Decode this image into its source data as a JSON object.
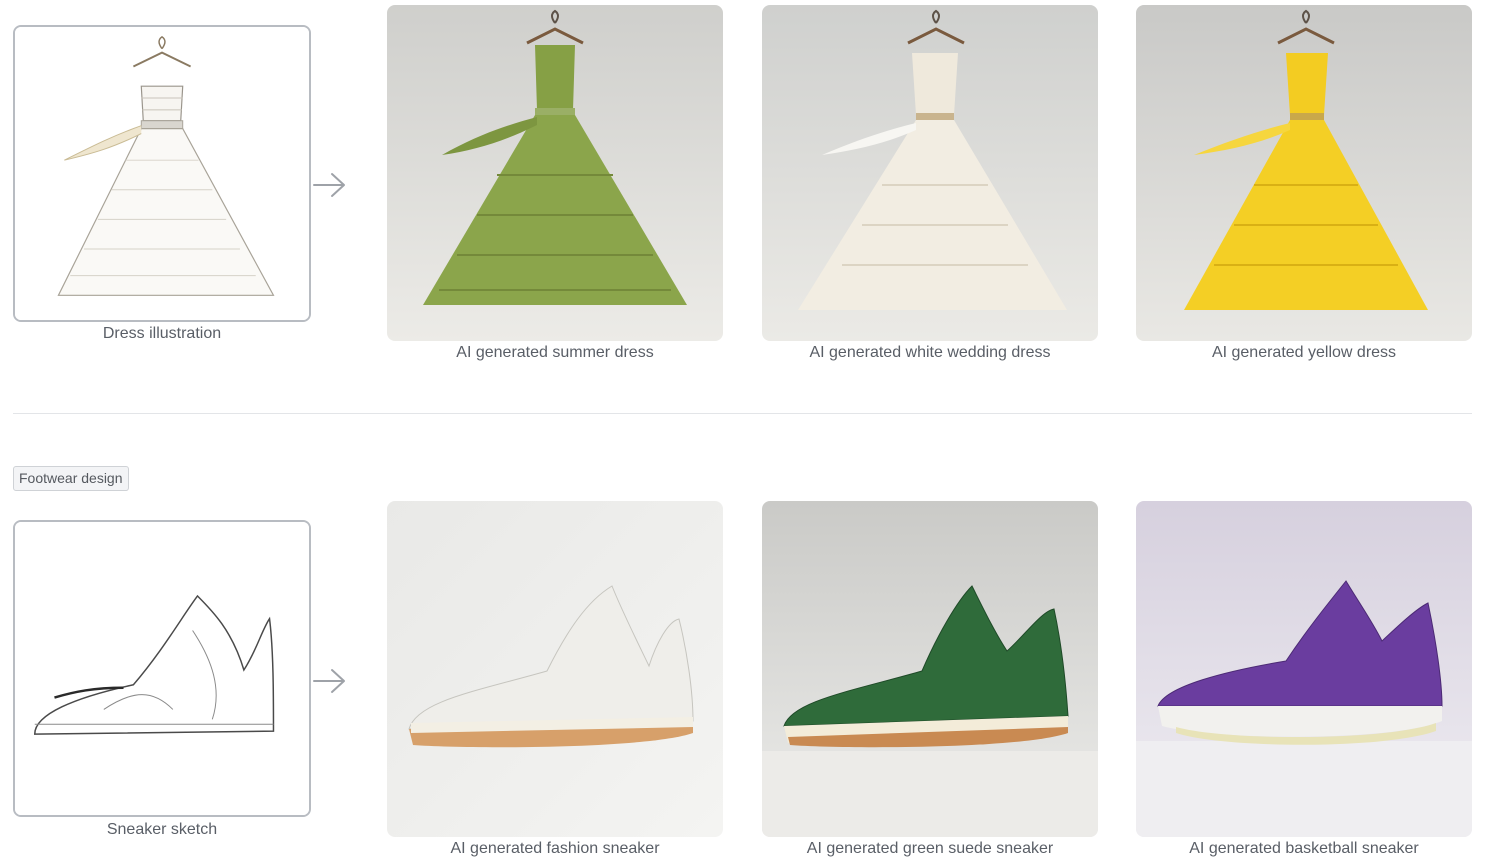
{
  "rows": [
    {
      "source": {
        "label": "Dress illustration",
        "icon": "dress-sketch"
      },
      "results": [
        {
          "label": "AI generated summer dress",
          "color": "#8ea44a"
        },
        {
          "label": "AI generated white wedding dress",
          "color": "#efe9dc"
        },
        {
          "label": "AI generated yellow dress",
          "color": "#f4cf25"
        }
      ]
    },
    {
      "section_tag": "Footwear design",
      "source": {
        "label": "Sneaker sketch",
        "icon": "sneaker-sketch"
      },
      "results": [
        {
          "label": "AI generated fashion sneaker",
          "color": "#eeeee9"
        },
        {
          "label": "AI generated green suede sneaker",
          "color": "#2f6b3a"
        },
        {
          "label": "AI generated basketball sneaker",
          "color": "#6a3d9f"
        }
      ]
    }
  ],
  "icons": {
    "arrow": "arrow-right-icon"
  }
}
